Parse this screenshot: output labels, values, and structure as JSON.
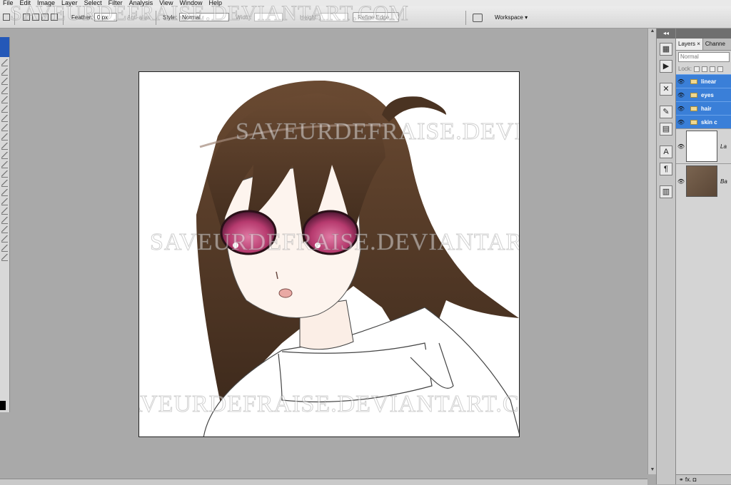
{
  "menu": [
    "File",
    "Edit",
    "Image",
    "Layer",
    "Select",
    "Filter",
    "Analysis",
    "View",
    "Window",
    "Help"
  ],
  "options": {
    "feather_label": "Feather:",
    "feather_value": "0 px",
    "antialias_label": "Anti-alias",
    "style_label": "Style:",
    "style_value": "Normal",
    "width_label": "Width:",
    "height_label": "Height:",
    "refine_edge": "Refine Edge...",
    "workspace": "Workspace ▾"
  },
  "watermark": "SAVEURDEFRAISE.DEVIANTART.COM",
  "layers_panel": {
    "tabs": [
      "Layers ×",
      "Channe"
    ],
    "blend_mode": "Normal",
    "lock_label": "Lock:",
    "groups": [
      {
        "name": "linear"
      },
      {
        "name": "eyes"
      },
      {
        "name": "hair"
      },
      {
        "name": "skin c"
      }
    ],
    "layers": [
      {
        "name": "La"
      },
      {
        "name": "Ba"
      }
    ],
    "footer": "⚭  fx.  ◘"
  },
  "dock_icons": [
    "dock-icon-1",
    "dock-icon-2",
    "tools-icon",
    "brush-icon",
    "stamp-icon",
    "character-icon",
    "paragraph-icon",
    "notes-icon"
  ],
  "colors": {
    "hair": "#4a3322",
    "eye": "#b63a6e",
    "selected_layer": "#3a7fd8"
  }
}
